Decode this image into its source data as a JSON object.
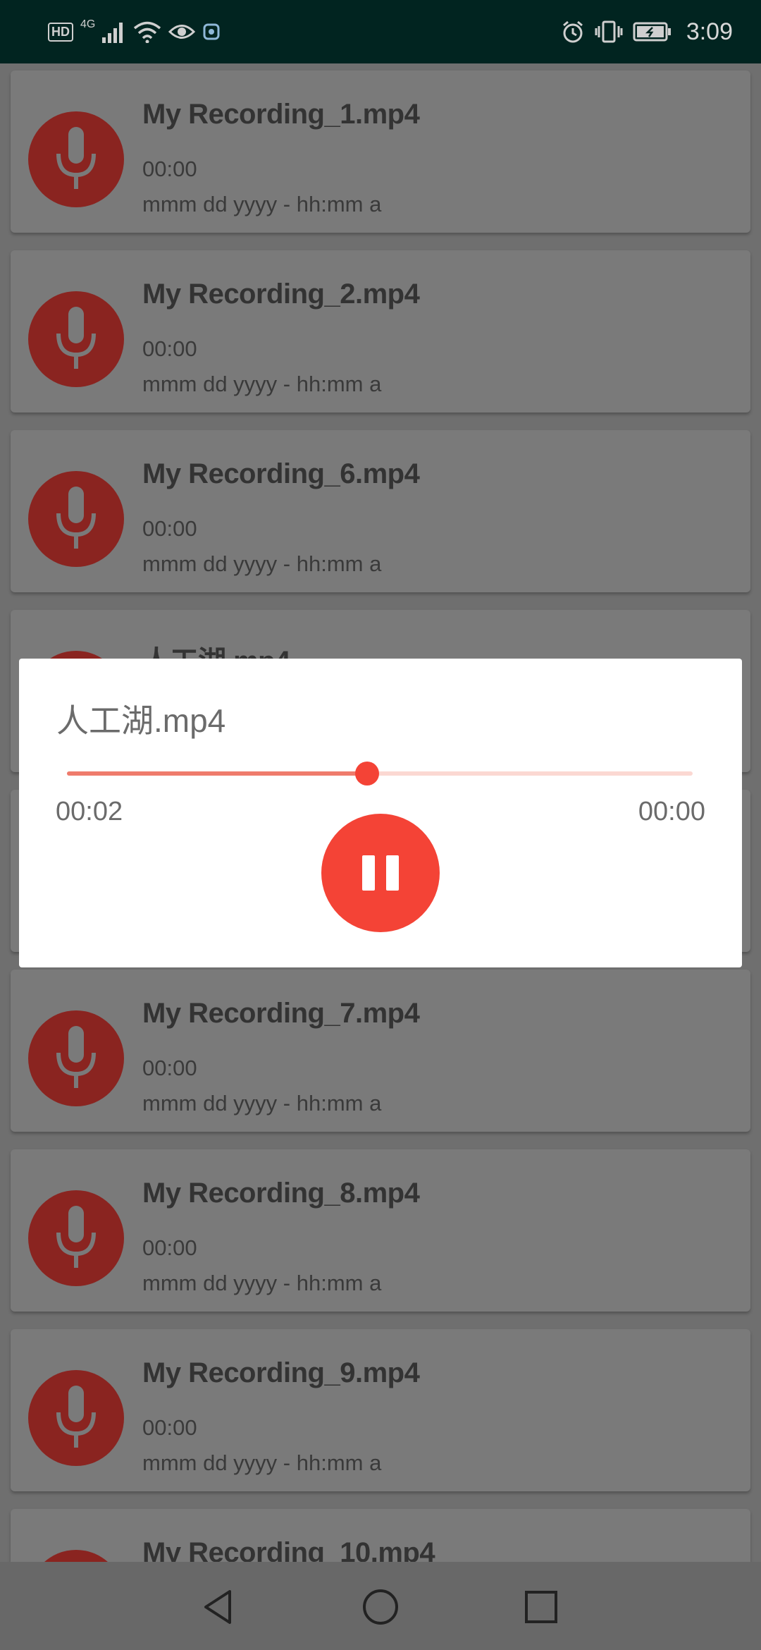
{
  "status_bar": {
    "hd": "HD",
    "network": "4G",
    "time": "3:09"
  },
  "recordings": [
    {
      "title": "My Recording_1.mp4",
      "duration": "00:00",
      "date": "mmm dd yyyy - hh:mm a"
    },
    {
      "title": "My Recording_2.mp4",
      "duration": "00:00",
      "date": "mmm dd yyyy - hh:mm a"
    },
    {
      "title": "My Recording_6.mp4",
      "duration": "00:00",
      "date": "mmm dd yyyy - hh:mm a"
    },
    {
      "title": "人工湖.mp4",
      "duration": "",
      "date": ""
    },
    {
      "title": "",
      "duration": "",
      "date": ""
    },
    {
      "title": "My Recording_7.mp4",
      "duration": "00:00",
      "date": "mmm dd yyyy - hh:mm a"
    },
    {
      "title": "My Recording_8.mp4",
      "duration": "00:00",
      "date": "mmm dd yyyy - hh:mm a"
    },
    {
      "title": "My Recording_9.mp4",
      "duration": "00:00",
      "date": "mmm dd yyyy - hh:mm a"
    },
    {
      "title": "My Recording_10.mp4",
      "duration": "",
      "date": ""
    }
  ],
  "player": {
    "title": "人工湖.mp4",
    "current_time": "00:02",
    "total_time": "00:00",
    "progress": 0.48
  },
  "colors": {
    "accent": "#f44336",
    "avatar_dimmed": "#8a2420",
    "status_bar": "#012420"
  },
  "icons": {
    "avatar": "microphone-icon",
    "player_control": "pause-icon",
    "nav": [
      "back-icon",
      "home-icon",
      "recents-icon"
    ]
  }
}
